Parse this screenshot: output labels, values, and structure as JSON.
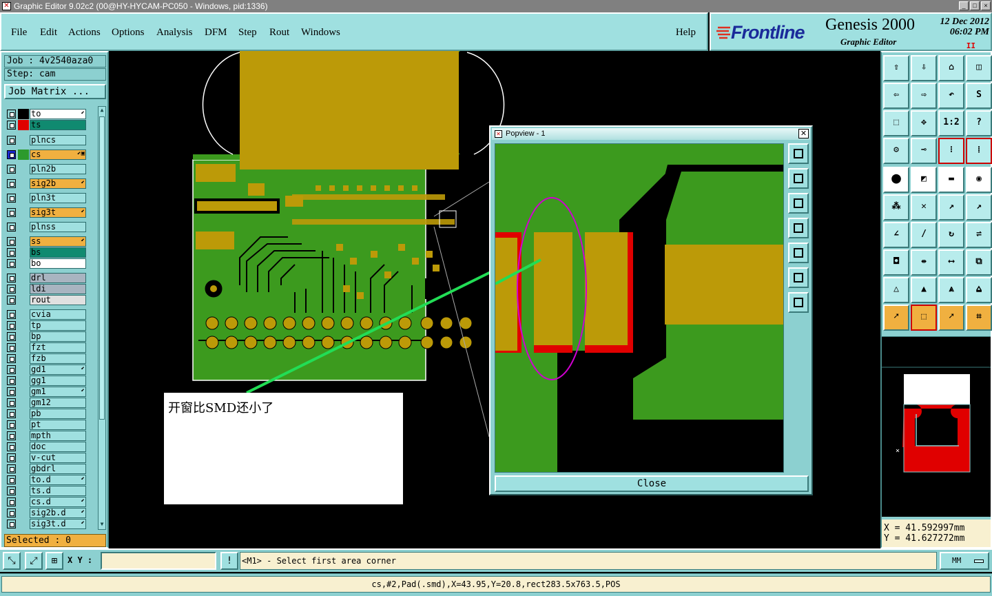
{
  "window": {
    "title": "Graphic Editor 9.02c2 (00@HY-HYCAM-PC050 - Windows, pid:1336)",
    "buttons": [
      "_",
      "□",
      "×"
    ]
  },
  "menu": {
    "items": [
      "File",
      "Edit",
      "Actions",
      "Options",
      "Analysis",
      "DFM",
      "Step",
      "Rout",
      "Windows"
    ],
    "help": "Help"
  },
  "brand": {
    "company": "Frontline",
    "product": "Genesis 2000",
    "subtitle": "Graphic Editor",
    "date_line1": "12 Dec 2012",
    "date_line2": "06:02 PM",
    "pause": "II"
  },
  "job": {
    "job_line": "Job : 4v2540aza0",
    "step_line": "Step: cam",
    "matrix_button": "Job Matrix ..."
  },
  "layers": [
    {
      "name": "to",
      "color": "#000000",
      "bg": "#ffffff",
      "flag": "⬋"
    },
    {
      "name": "ts",
      "color": "#e00000",
      "bg": "#108a70",
      "flag": ""
    },
    {
      "name": "plncs",
      "color": "#8cd0d0",
      "bg": "#9fe0e0",
      "flag": ""
    },
    {
      "name": "cs",
      "color": "#2c9a2c",
      "bg": "#f0b040",
      "flag": "⬋▣",
      "active": true
    },
    {
      "name": "pln2b",
      "color": "#8cd0d0",
      "bg": "#9fe0e0",
      "flag": ""
    },
    {
      "name": "sig2b",
      "color": "#8cd0d0",
      "bg": "#f0b040",
      "flag": "⬋"
    },
    {
      "name": "pln3t",
      "color": "#8cd0d0",
      "bg": "#9fe0e0",
      "flag": ""
    },
    {
      "name": "sig3t",
      "color": "#8cd0d0",
      "bg": "#f0b040",
      "flag": "⬋"
    },
    {
      "name": "plnss",
      "color": "#8cd0d0",
      "bg": "#9fe0e0",
      "flag": ""
    },
    {
      "name": "ss",
      "color": "#8cd0d0",
      "bg": "#f0b040",
      "flag": "⬋"
    },
    {
      "name": "bs",
      "color": "#8cd0d0",
      "bg": "#108a70",
      "flag": ""
    },
    {
      "name": "bo",
      "color": "#8cd0d0",
      "bg": "#ffffff",
      "flag": ""
    },
    {
      "name": "drl",
      "color": "#8cd0d0",
      "bg": "#a8b4c0",
      "flag": ""
    },
    {
      "name": "ldi",
      "color": "#8cd0d0",
      "bg": "#a8b4c0",
      "flag": ""
    },
    {
      "name": "rout",
      "color": "#8cd0d0",
      "bg": "#e0e0e0",
      "flag": ""
    },
    {
      "name": "cvia",
      "color": "#8cd0d0",
      "bg": "#9fe0e0",
      "flag": ""
    },
    {
      "name": "tp",
      "color": "#8cd0d0",
      "bg": "#9fe0e0",
      "flag": ""
    },
    {
      "name": "bp",
      "color": "#8cd0d0",
      "bg": "#9fe0e0",
      "flag": ""
    },
    {
      "name": "fzt",
      "color": "#8cd0d0",
      "bg": "#9fe0e0",
      "flag": ""
    },
    {
      "name": "fzb",
      "color": "#8cd0d0",
      "bg": "#9fe0e0",
      "flag": ""
    },
    {
      "name": "gd1",
      "color": "#8cd0d0",
      "bg": "#9fe0e0",
      "flag": "⬋"
    },
    {
      "name": "gg1",
      "color": "#8cd0d0",
      "bg": "#9fe0e0",
      "flag": ""
    },
    {
      "name": "gm1",
      "color": "#8cd0d0",
      "bg": "#9fe0e0",
      "flag": "⬋"
    },
    {
      "name": "gm12",
      "color": "#8cd0d0",
      "bg": "#9fe0e0",
      "flag": ""
    },
    {
      "name": "pb",
      "color": "#8cd0d0",
      "bg": "#9fe0e0",
      "flag": ""
    },
    {
      "name": "pt",
      "color": "#8cd0d0",
      "bg": "#9fe0e0",
      "flag": ""
    },
    {
      "name": "mpth",
      "color": "#8cd0d0",
      "bg": "#9fe0e0",
      "flag": ""
    },
    {
      "name": "doc",
      "color": "#8cd0d0",
      "bg": "#9fe0e0",
      "flag": ""
    },
    {
      "name": "v-cut",
      "color": "#8cd0d0",
      "bg": "#9fe0e0",
      "flag": ""
    },
    {
      "name": "gbdrl",
      "color": "#8cd0d0",
      "bg": "#9fe0e0",
      "flag": ""
    },
    {
      "name": "to.d",
      "color": "#8cd0d0",
      "bg": "#9fe0e0",
      "flag": "⬋"
    },
    {
      "name": "ts.d",
      "color": "#8cd0d0",
      "bg": "#9fe0e0",
      "flag": ""
    },
    {
      "name": "cs.d",
      "color": "#8cd0d0",
      "bg": "#9fe0e0",
      "flag": "⬋"
    },
    {
      "name": "sig2b.d",
      "color": "#8cd0d0",
      "bg": "#9fe0e0",
      "flag": "⬋"
    },
    {
      "name": "sig3t.d",
      "color": "#8cd0d0",
      "bg": "#9fe0e0",
      "flag": "⬋"
    }
  ],
  "selected": "Selected : 0",
  "annotation": "开窗比SMD还小了",
  "popview": {
    "title": "Popview - 1",
    "close_label": "Close"
  },
  "toolbar": {
    "zoom_ratio_label": "1:2",
    "help_label": "?"
  },
  "coords": {
    "x": "X  = 41.592997mm",
    "y": "Y  = 41.627272mm"
  },
  "bottom": {
    "xy_label": "X Y :",
    "xy_value": "",
    "alert": "!",
    "prompt": "<M1> - Select first area corner",
    "units": "MM"
  },
  "status": "cs,#2,Pad(.smd),X=43.95,Y=20.8,rect283.5x763.5,POS",
  "colors": {
    "copper": "#bc9a08",
    "laminate": "#3c9a1e",
    "mask": "#e00000",
    "accent": "#9fe0e0"
  }
}
